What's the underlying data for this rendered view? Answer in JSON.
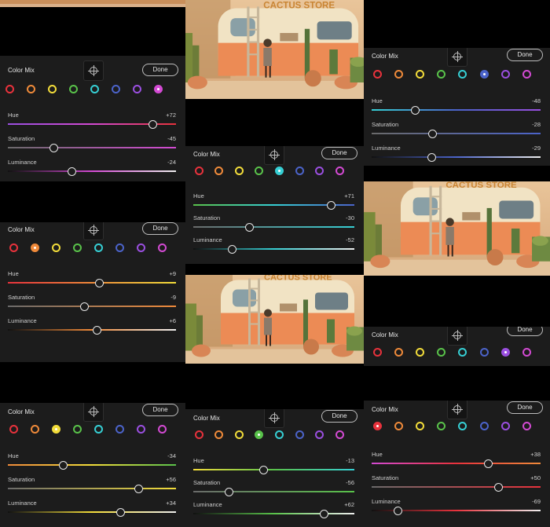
{
  "colors": {
    "red": "#e8323c",
    "orange": "#ef8a3a",
    "yellow": "#f2dc3a",
    "green": "#59c24a",
    "aqua": "#36cfd4",
    "blue": "#4b63c9",
    "purple": "#9a4fe0",
    "magenta": "#d34ad3"
  },
  "swatch_order": [
    "red",
    "orange",
    "yellow",
    "green",
    "aqua",
    "blue",
    "purple",
    "magenta"
  ],
  "photo": {
    "sign_text": "CACTUS STORE",
    "icon": "van-cactus-photo"
  },
  "panels": [
    {
      "id": "p1",
      "title": "Color Mix",
      "done_label": "Done",
      "selected": "magenta",
      "sliders": [
        {
          "label": "Hue",
          "value": "+72",
          "amount": 72
        },
        {
          "label": "Saturation",
          "value": "-45",
          "amount": -45
        },
        {
          "label": "Luminance",
          "value": "-24",
          "amount": -24
        }
      ]
    },
    {
      "id": "p2",
      "title": "Color Mix",
      "done_label": "Done",
      "selected": "blue",
      "sliders": [
        {
          "label": "Hue",
          "value": "-48",
          "amount": -48
        },
        {
          "label": "Saturation",
          "value": "-28",
          "amount": -28
        },
        {
          "label": "Luminance",
          "value": "-29",
          "amount": -29
        }
      ]
    },
    {
      "id": "p3",
      "title": "Color Mix",
      "done_label": "Done",
      "selected": "aqua",
      "sliders": [
        {
          "label": "Hue",
          "value": "+71",
          "amount": 71
        },
        {
          "label": "Saturation",
          "value": "-30",
          "amount": -30
        },
        {
          "label": "Luminance",
          "value": "-52",
          "amount": -52
        }
      ]
    },
    {
      "id": "p4",
      "title": "Color Mix",
      "done_label": "Done",
      "selected": "orange",
      "sliders": [
        {
          "label": "Hue",
          "value": "+9",
          "amount": 9
        },
        {
          "label": "Saturation",
          "value": "-9",
          "amount": -9
        },
        {
          "label": "Luminance",
          "value": "+6",
          "amount": 6
        }
      ]
    },
    {
      "id": "p5",
      "title": "Color Mix",
      "done_label": "Done",
      "selected": "purple",
      "sliders": []
    },
    {
      "id": "p6",
      "title": "Color Mix",
      "done_label": "Done",
      "selected": "yellow",
      "sliders": [
        {
          "label": "Hue",
          "value": "-34",
          "amount": -34
        },
        {
          "label": "Saturation",
          "value": "+56",
          "amount": 56
        },
        {
          "label": "Luminance",
          "value": "+34",
          "amount": 34
        }
      ]
    },
    {
      "id": "p7",
      "title": "Color Mix",
      "done_label": "Done",
      "selected": "green",
      "sliders": [
        {
          "label": "Hue",
          "value": "-13",
          "amount": -13
        },
        {
          "label": "Saturation",
          "value": "-56",
          "amount": -56
        },
        {
          "label": "Luminance",
          "value": "+62",
          "amount": 62
        }
      ]
    },
    {
      "id": "p8",
      "title": "Color Mix",
      "done_label": "Done",
      "selected": "red",
      "sliders": [
        {
          "label": "Hue",
          "value": "+38",
          "amount": 38
        },
        {
          "label": "Saturation",
          "value": "+50",
          "amount": 50
        },
        {
          "label": "Luminance",
          "value": "-69",
          "amount": -69
        }
      ]
    }
  ]
}
